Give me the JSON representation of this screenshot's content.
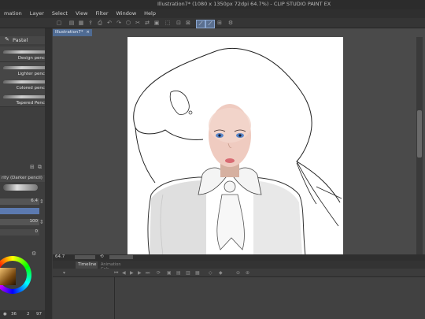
{
  "app": {
    "title": "Illustration7* (1080 x 1350px 72dpi 64.7%)  - CLIP STUDIO PAINT EX"
  },
  "menu": [
    "mation",
    "Layer",
    "Select",
    "View",
    "Filter",
    "Window",
    "Help"
  ],
  "document_tab": "Illustration7*",
  "subtool": {
    "group_label": "Pastel",
    "brushes": [
      "Design pencil",
      "Lighter pencil",
      "Colored pencil",
      "Tapered Pencil"
    ]
  },
  "brush_property": {
    "header": "rity (Darker pencil)",
    "size_value": "6.4",
    "opacity_value": "100",
    "extra_value": "0"
  },
  "left_status": {
    "a": "36",
    "b": "2",
    "c": "97"
  },
  "canvas_status": {
    "zoom": "64.7"
  },
  "timeline": {
    "tab_label": "Timeline",
    "tab2_label": "Animation Cels"
  },
  "colors": {
    "accent": "#4f6b93",
    "panel": "#3e3e3e",
    "canvas_bg": "#4a4a4a"
  }
}
